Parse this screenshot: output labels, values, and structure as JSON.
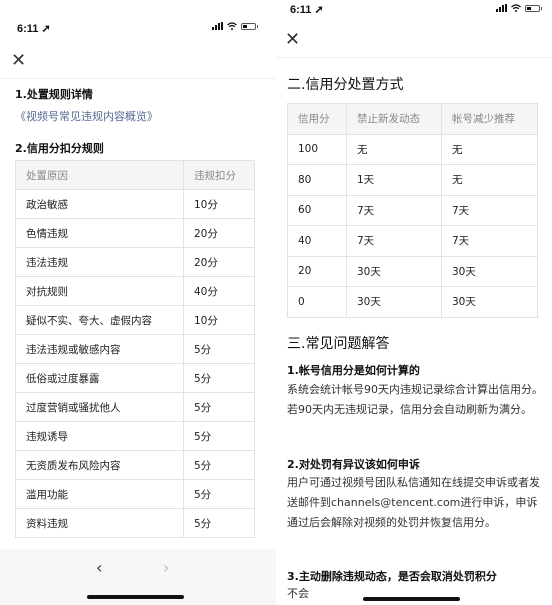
{
  "status_bar": {
    "time": "6:11",
    "location_icon": "location-arrow-icon",
    "icons": [
      "signal-icon",
      "wifi-icon",
      "battery-icon"
    ]
  },
  "left_screen": {
    "close_icon": "close-icon",
    "section1_title": "1.处置规则详情",
    "section1_link": "《视频号常见违规内容概览》",
    "section2_title": "2.信用分扣分规则",
    "deduction_table": {
      "headers": [
        "处置原因",
        "违规扣分"
      ],
      "rows": [
        [
          "政治敏感",
          "10分"
        ],
        [
          "色情违规",
          "20分"
        ],
        [
          "违法违规",
          "20分"
        ],
        [
          "对抗规则",
          "40分"
        ],
        [
          "疑似不实、夸大、虚假内容",
          "10分"
        ],
        [
          "违法违规或敏感内容",
          "5分"
        ],
        [
          "低俗或过度暴露",
          "5分"
        ],
        [
          "过度营销或骚扰他人",
          "5分"
        ],
        [
          "违规诱导",
          "5分"
        ],
        [
          "无资质发布风险内容",
          "5分"
        ],
        [
          "滥用功能",
          "5分"
        ],
        [
          "资料违规",
          "5分"
        ]
      ]
    },
    "bottom_nav": {
      "back": "‹",
      "forward": "›"
    }
  },
  "right_screen": {
    "close_icon": "close-icon",
    "section2_title": "二.信用分处置方式",
    "penalty_table": {
      "headers": [
        "信用分",
        "禁止新发动态",
        "帐号减少推荐"
      ],
      "rows": [
        [
          "100",
          "无",
          "无"
        ],
        [
          "80",
          "1天",
          "无"
        ],
        [
          "60",
          "7天",
          "7天"
        ],
        [
          "40",
          "7天",
          "7天"
        ],
        [
          "20",
          "30天",
          "30天"
        ],
        [
          "0",
          "30天",
          "30天"
        ]
      ]
    },
    "section3_title": "三.常见问题解答",
    "faq": [
      {
        "question": "1.帐号信用分是如何计算的",
        "answer": "系统会统计帐号90天内违规记录综合计算出信用分。若90天内无违规记录，信用分会自动刷新为满分。"
      },
      {
        "question": "2.对处罚有异议该如何申诉",
        "answer": "用户可通过视频号团队私信通知在线提交申诉或者发送邮件到channels@tencent.com进行申诉，申诉通过后会解除对视频的处罚并恢复信用分。"
      },
      {
        "question": "3.主动删除违规动态，是否会取消处罚积分",
        "answer": "不会"
      }
    ]
  },
  "colors": {
    "link": "#576b95",
    "table_header_bg": "#f5f5f5",
    "table_border": "#e2e2e2",
    "bottom_bar_bg": "#f7f7f7"
  }
}
